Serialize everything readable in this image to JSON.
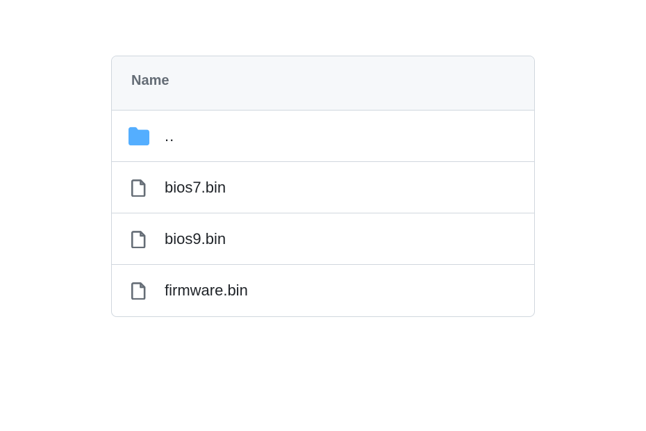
{
  "header": {
    "name_column_label": "Name"
  },
  "rows": [
    {
      "type": "folder",
      "name": ".."
    },
    {
      "type": "file",
      "name": "bios7.bin"
    },
    {
      "type": "file",
      "name": "bios9.bin"
    },
    {
      "type": "file",
      "name": "firmware.bin"
    }
  ]
}
